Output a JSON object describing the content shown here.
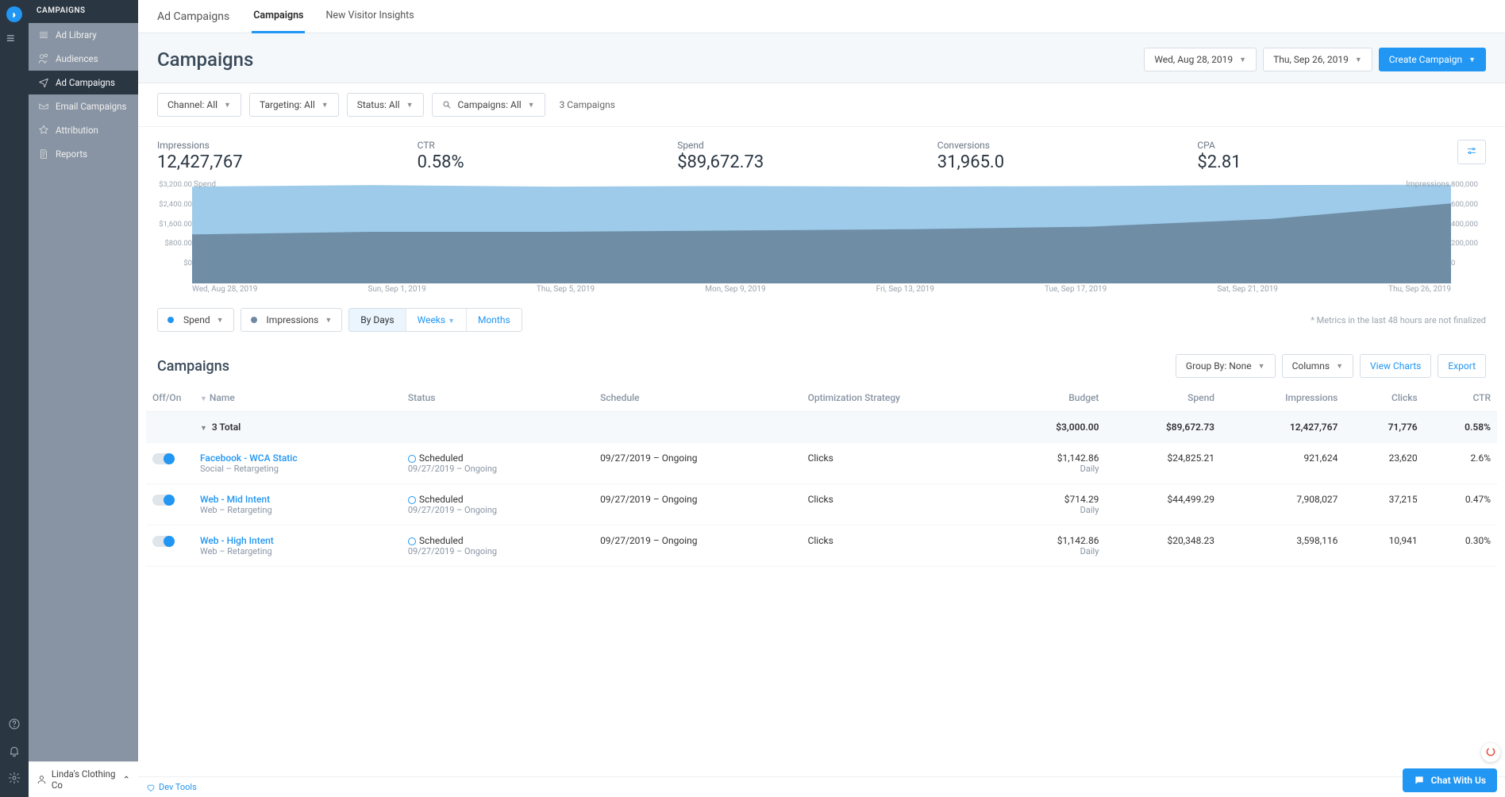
{
  "colors": {
    "accent": "#2196f3",
    "spend": "#2196f3",
    "impressions": "#6d8aa2"
  },
  "sidebar": {
    "heading": "CAMPAIGNS",
    "items": [
      {
        "label": "Ad Library",
        "active": false
      },
      {
        "label": "Audiences",
        "active": false
      },
      {
        "label": "Ad Campaigns",
        "active": true
      },
      {
        "label": "Email Campaigns",
        "active": false
      },
      {
        "label": "Attribution",
        "active": false
      },
      {
        "label": "Reports",
        "active": false
      }
    ],
    "footer_account": "Linda's Clothing Co"
  },
  "topnav": {
    "crumb": "Ad Campaigns",
    "tabs": [
      {
        "label": "Campaigns",
        "active": true
      },
      {
        "label": "New Visitor Insights",
        "active": false
      }
    ]
  },
  "titlebar": {
    "title": "Campaigns",
    "date_start": "Wed, Aug 28, 2019",
    "date_end": "Thu, Sep 26, 2019",
    "create_label": "Create Campaign"
  },
  "filters": {
    "channel": "Channel: All",
    "targeting": "Targeting: All",
    "status": "Status: All",
    "campaigns": "Campaigns: All",
    "count": "3 Campaigns"
  },
  "metrics": [
    {
      "label": "Impressions",
      "value": "12,427,767"
    },
    {
      "label": "CTR",
      "value": "0.58%"
    },
    {
      "label": "Spend",
      "value": "$89,672.73"
    },
    {
      "label": "Conversions",
      "value": "31,965.0"
    },
    {
      "label": "CPA",
      "value": "$2.81"
    }
  ],
  "chart_data": {
    "type": "area",
    "x": [
      "Wed, Aug 28, 2019",
      "Sun, Sep 1, 2019",
      "Thu, Sep 5, 2019",
      "Mon, Sep 9, 2019",
      "Fri, Sep 13, 2019",
      "Tue, Sep 17, 2019",
      "Sat, Sep 21, 2019",
      "Thu, Sep 26, 2019"
    ],
    "series": [
      {
        "name": "Spend",
        "color": "#94c5e8",
        "axis": "left",
        "values": [
          3000,
          3050,
          3000,
          3020,
          3000,
          3020,
          3050,
          3060
        ]
      },
      {
        "name": "Impressions",
        "color": "#6d8aa2",
        "axis": "right",
        "values": [
          380000,
          400000,
          400000,
          410000,
          420000,
          440000,
          500000,
          620000
        ]
      }
    ],
    "yleft": {
      "label": "Spend",
      "ticks": [
        "$3,200.00",
        "$2,400.00",
        "$1,600.00",
        "$800.00",
        "$0"
      ],
      "min": 0,
      "max": 3200
    },
    "yright": {
      "label": "Impressions",
      "ticks": [
        "800,000",
        "600,000",
        "400,000",
        "200,000",
        "0"
      ],
      "min": 0,
      "max": 800000
    }
  },
  "chart_controls": {
    "legend": [
      {
        "label": "Spend",
        "color": "#2196f3"
      },
      {
        "label": "Impressions",
        "color": "#6d8aa2"
      }
    ],
    "granularity": [
      {
        "label": "By Days",
        "active": true
      },
      {
        "label": "Weeks",
        "active": false
      },
      {
        "label": "Months",
        "active": false
      }
    ],
    "note": "* Metrics in the last 48 hours are not finalized"
  },
  "table": {
    "title": "Campaigns",
    "group_by": "Group By: None",
    "columns_btn": "Columns",
    "view_charts": "View Charts",
    "export": "Export",
    "headers": {
      "toggle": "Off/On",
      "name": "Name",
      "status": "Status",
      "schedule": "Schedule",
      "strategy": "Optimization Strategy",
      "budget": "Budget",
      "spend": "Spend",
      "impressions": "Impressions",
      "clicks": "Clicks",
      "ctr": "CTR"
    },
    "totals": {
      "label": "3 Total",
      "budget": "$3,000.00",
      "spend": "$89,672.73",
      "impressions": "12,427,767",
      "clicks": "71,776",
      "ctr": "0.58%"
    },
    "rows": [
      {
        "name": "Facebook - WCA Static",
        "sub": "Social – Retargeting",
        "status": "Scheduled",
        "status_sub": "09/27/2019 – Ongoing",
        "schedule": "09/27/2019 – Ongoing",
        "strategy": "Clicks",
        "budget": "$1,142.86",
        "budget_sub": "Daily",
        "spend": "$24,825.21",
        "impressions": "921,624",
        "clicks": "23,620",
        "ctr": "2.6%"
      },
      {
        "name": "Web - Mid Intent",
        "sub": "Web – Retargeting",
        "status": "Scheduled",
        "status_sub": "09/27/2019 – Ongoing",
        "schedule": "09/27/2019 – Ongoing",
        "strategy": "Clicks",
        "budget": "$714.29",
        "budget_sub": "Daily",
        "spend": "$44,499.29",
        "impressions": "7,908,027",
        "clicks": "37,215",
        "ctr": "0.47%"
      },
      {
        "name": "Web - High Intent",
        "sub": "Web – Retargeting",
        "status": "Scheduled",
        "status_sub": "09/27/2019 – Ongoing",
        "schedule": "09/27/2019 – Ongoing",
        "strategy": "Clicks",
        "budget": "$1,142.86",
        "budget_sub": "Daily",
        "spend": "$20,348.23",
        "impressions": "3,598,116",
        "clicks": "10,941",
        "ctr": "0.30%"
      }
    ]
  },
  "footer": {
    "devtools": "Dev Tools",
    "chat": "Chat With Us"
  }
}
